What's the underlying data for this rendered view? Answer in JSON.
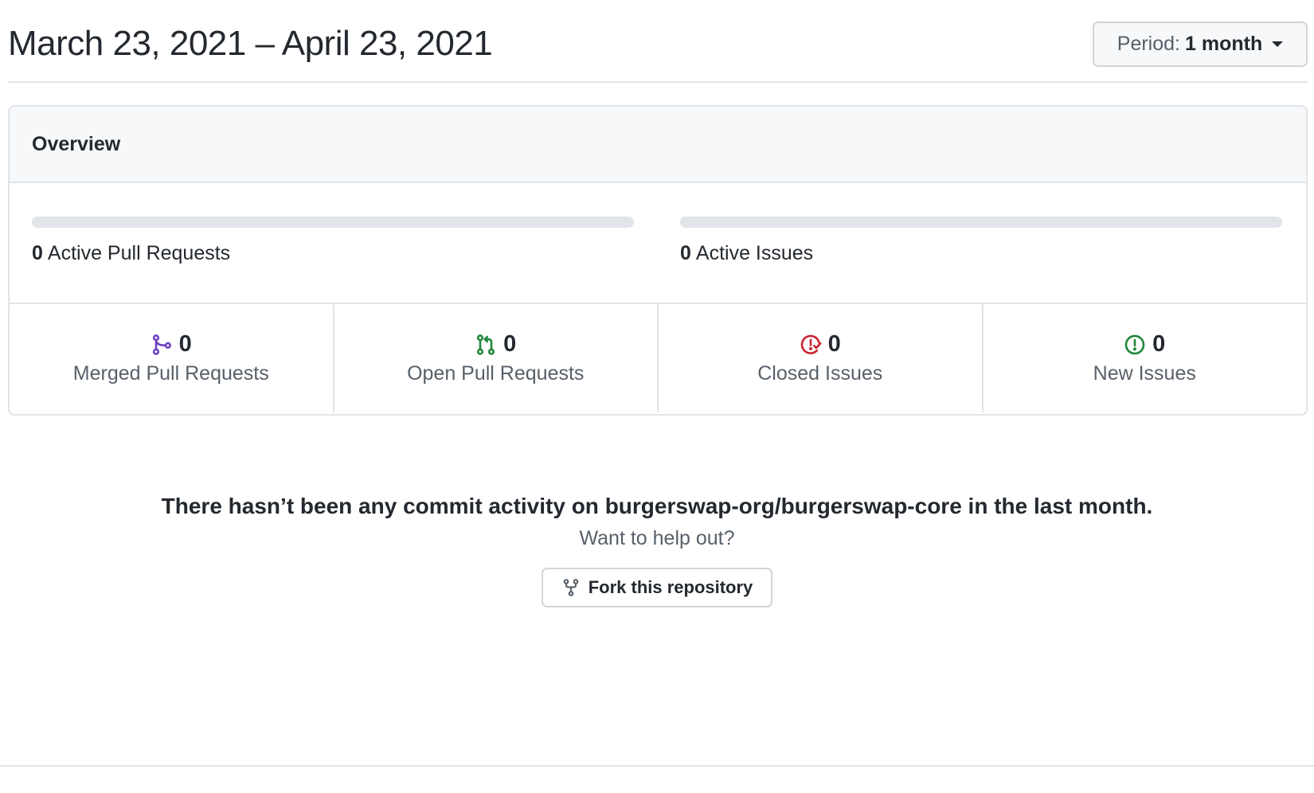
{
  "header": {
    "date_range": "March 23, 2021 – April 23, 2021",
    "period_prefix": "Period:",
    "period_value": "1 month"
  },
  "overview": {
    "title": "Overview",
    "pull_requests_bar": {
      "count": "0",
      "label": "Active Pull Requests",
      "fill_fraction": 0
    },
    "issues_bar": {
      "count": "0",
      "label": "Active Issues",
      "fill_fraction": 0
    },
    "stats": [
      {
        "icon": "git-merge-icon",
        "count": "0",
        "label": "Merged Pull Requests",
        "color": "#6f42c1"
      },
      {
        "icon": "git-pull-request-icon",
        "count": "0",
        "label": "Open Pull Requests",
        "color": "#22863a"
      },
      {
        "icon": "issue-closed-icon",
        "count": "0",
        "label": "Closed Issues",
        "color": "#cb2431"
      },
      {
        "icon": "issue-opened-icon",
        "count": "0",
        "label": "New Issues",
        "color": "#22863a"
      }
    ]
  },
  "empty_state": {
    "message": "There hasn’t been any commit activity on burgerswap-org/burgerswap-core in the last month.",
    "subtext": "Want to help out?",
    "fork_button": "Fork this repository"
  },
  "colors": {
    "text": "#24292f",
    "muted": "#586069",
    "border": "#e1e4e8",
    "purple": "#6f42c1",
    "green": "#22863a",
    "red": "#cb2431"
  }
}
